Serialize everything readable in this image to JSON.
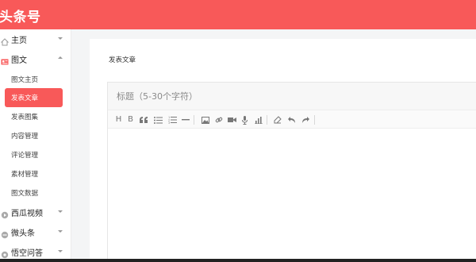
{
  "header": {
    "logo": "头条号",
    "bg_color": "#f85959"
  },
  "sidebar": {
    "items": [
      {
        "label": "主页",
        "icon": "home-icon",
        "expanded": false
      },
      {
        "label": "图文",
        "icon": "article-icon",
        "expanded": true,
        "children": [
          "图文主页",
          "发表文章",
          "发表图集",
          "内容管理",
          "评论管理",
          "素材管理",
          "图文数据"
        ],
        "active_child": "发表文章"
      },
      {
        "label": "西瓜视频",
        "icon": "video-icon",
        "expanded": false
      },
      {
        "label": "微头条",
        "icon": "micro-icon",
        "expanded": false
      },
      {
        "label": "悟空问答",
        "icon": "qa-icon",
        "expanded": false
      }
    ]
  },
  "main": {
    "title": "发表文章",
    "editor": {
      "title_placeholder": "标题（5-30个字符）",
      "toolbar": [
        "heading",
        "bold",
        "quote",
        "unordered-list",
        "ordered-list",
        "horizontal-rule",
        "image",
        "link",
        "video",
        "audio",
        "chart",
        "eraser",
        "undo",
        "redo"
      ]
    }
  },
  "colors": {
    "accent": "#f85959",
    "sidebar_bg": "#ffffff",
    "page_bg": "#f4f5f6"
  }
}
